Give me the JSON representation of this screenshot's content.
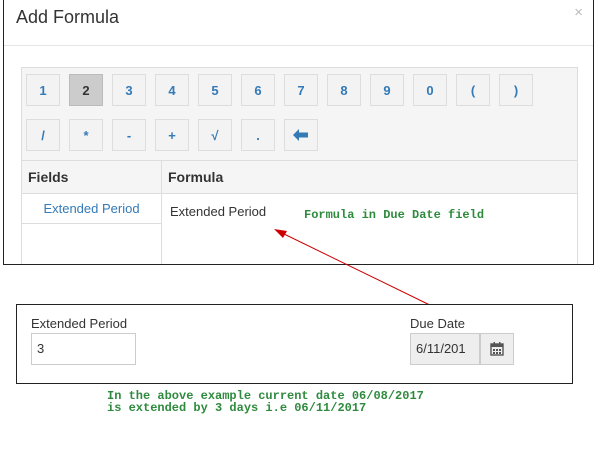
{
  "modal": {
    "title": "Add Formula",
    "close_label": "×",
    "keypad": [
      "1",
      "2",
      "3",
      "4",
      "5",
      "6",
      "7",
      "8",
      "9",
      "0",
      "(",
      ")",
      "/",
      "*",
      "-",
      "+",
      "√",
      "."
    ],
    "active_key": "2",
    "table": {
      "fields_header": "Fields",
      "formula_header": "Formula",
      "fields": [
        "Extended Period"
      ],
      "formula_value": "Extended Period"
    }
  },
  "annotation_top": "Formula in Due Date field",
  "form": {
    "extended_period_label": "Extended Period",
    "extended_period_value": "3",
    "due_date_label": "Due Date",
    "due_date_value": "6/11/201"
  },
  "annotation_bottom": "In the above example current date 06/08/2017\nis extended by 3 days i.e 06/11/2017",
  "colors": {
    "link": "#337ab7",
    "annotation": "#2e8b3e",
    "arrow": "#cc0000"
  }
}
